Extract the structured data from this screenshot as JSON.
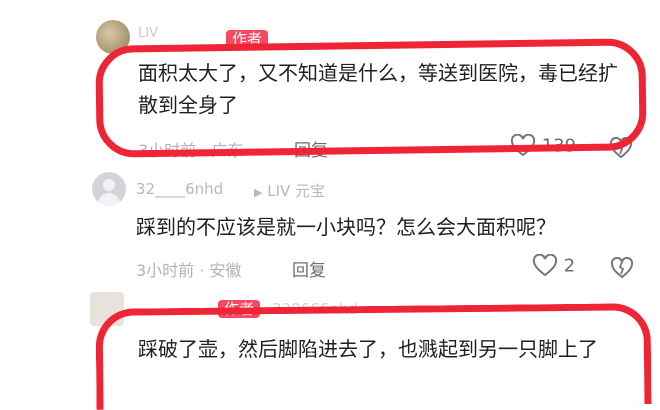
{
  "comments": [
    {
      "username": "LIV",
      "badge": "作者",
      "text": "面积太大了，又不知道是什么，等送到医院，毒已经扩散到全身了",
      "time_location": "3小时前 · 广东",
      "reply_label": "回复",
      "like_count": "139"
    },
    {
      "username": "32____6nhd",
      "level_badge": "LIV 元宝",
      "text": "踩到的不应该是就一小块吗？怎么会大面积呢？",
      "time_location": "3小时前 · 安徽",
      "reply_label": "回复",
      "like_count": "2"
    },
    {
      "username": "329666nhd",
      "badge": "作者",
      "text": "踩破了壶，然后脚陷进去了，也溅起到另一只脚上了"
    }
  ],
  "colors": {
    "highlight": "#ef2434",
    "badge": "#f6485f"
  },
  "icons": {
    "like": "heart-outline-icon",
    "dislike": "broken-heart-icon",
    "level": "triangle-right-icon"
  }
}
